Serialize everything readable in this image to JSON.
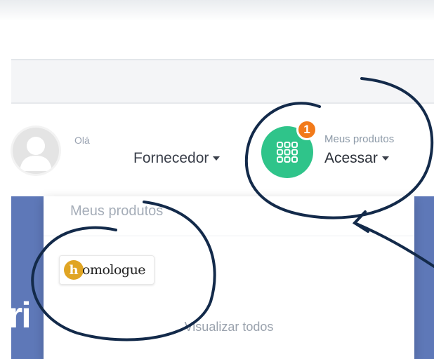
{
  "header": {
    "greeting": "Olá",
    "role_label": "Fornecedor",
    "products_subtitle": "Meus produtos",
    "products_action": "Acessar",
    "notification_count": "1"
  },
  "dropdown": {
    "title": "Meus produtos",
    "product_logo_text": "omologue",
    "product_logo_initial": "h",
    "view_all_label": "Visualizar todos"
  },
  "background": {
    "partial_text": "ri"
  },
  "colors": {
    "products_icon_bg": "#2fc48a",
    "badge_bg": "#f27a1a",
    "annotation_stroke": "#132a4a",
    "background_panel": "#5e78b8"
  },
  "icons": {
    "products": "apps-grid-icon",
    "avatar": "user-avatar-icon",
    "caret": "caret-down-icon"
  }
}
